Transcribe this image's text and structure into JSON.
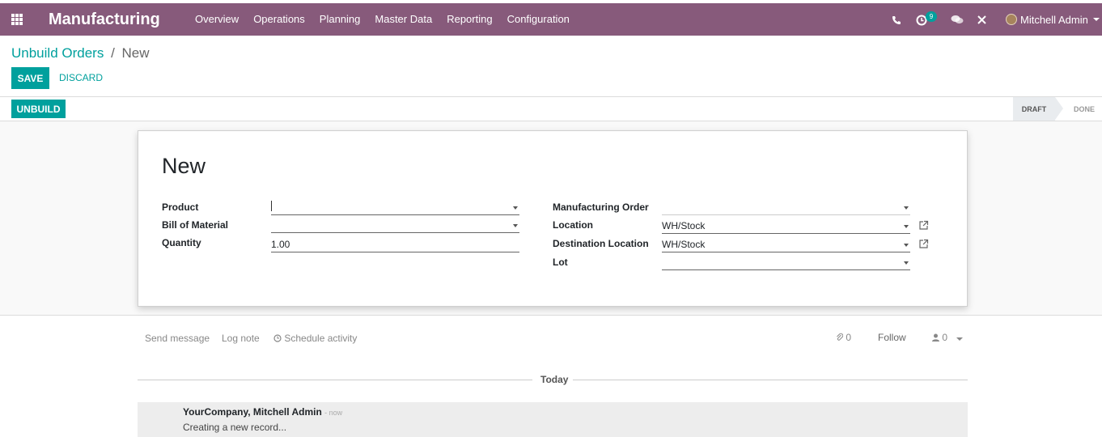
{
  "navbar": {
    "app_name": "Manufacturing",
    "menu": [
      "Overview",
      "Operations",
      "Planning",
      "Master Data",
      "Reporting",
      "Configuration"
    ],
    "activity_count": "9",
    "user_name": "Mitchell Admin",
    "color": "#875a7b"
  },
  "control_panel": {
    "breadcrumb_parent": "Unbuild Orders",
    "breadcrumb_sep": "/",
    "breadcrumb_current": "New",
    "save_label": "SAVE",
    "discard_label": "DISCARD"
  },
  "statusbar": {
    "action_label": "UNBUILD",
    "stages": [
      "DRAFT",
      "DONE"
    ],
    "active_stage": "DRAFT"
  },
  "form": {
    "title": "New",
    "product_label": "Product",
    "product_value": "",
    "bom_label": "Bill of Material",
    "bom_value": "",
    "quantity_label": "Quantity",
    "quantity_value": "1.00",
    "mo_label": "Manufacturing Order",
    "mo_value": "",
    "location_label": "Location",
    "location_value": "WH/Stock",
    "dest_location_label": "Destination Location",
    "dest_location_value": "WH/Stock",
    "lot_label": "Lot",
    "lot_value": ""
  },
  "chatter": {
    "send_message": "Send message",
    "log_note": "Log note",
    "schedule_activity": "Schedule activity",
    "attachments_count": "0",
    "follow_label": "Follow",
    "followers_count": "0",
    "date_separator": "Today",
    "message_author": "YourCompany, Mitchell Admin",
    "message_time": "- now",
    "message_body": "Creating a new record..."
  },
  "colors": {
    "accent": "#00a09d",
    "brand": "#875a7b"
  }
}
